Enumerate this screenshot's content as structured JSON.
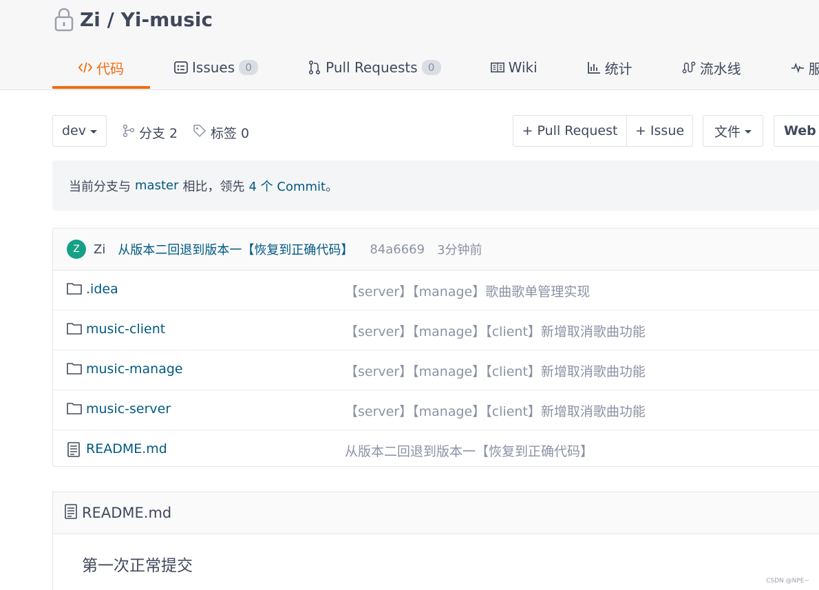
{
  "repo": {
    "title": "Zi / Yi-music"
  },
  "tabs": [
    {
      "label": "代码",
      "icon": "code-icon",
      "active": true
    },
    {
      "label": "Issues",
      "icon": "issues-icon",
      "count": "0"
    },
    {
      "label": "Pull Requests",
      "icon": "pull-request-icon",
      "count": "0"
    },
    {
      "label": "Wiki",
      "icon": "book-icon"
    },
    {
      "label": "统计",
      "icon": "bar-chart-icon"
    },
    {
      "label": "流水线",
      "icon": "pipeline-icon"
    },
    {
      "label": "服务",
      "icon": "pulse-icon"
    }
  ],
  "toolbar": {
    "branch": "dev",
    "branches_label": "分支 2",
    "tags_label": "标签 0",
    "pull_request_label": "+ Pull Request",
    "issue_label": "+ Issue",
    "file_label": "文件",
    "web_label": "Web"
  },
  "notice": {
    "prefix": "当前分支与",
    "branch": "master",
    "middle": "相比，领先",
    "commits": "4 个 Commit",
    "suffix": "。"
  },
  "last_commit": {
    "avatar_letter": "Z",
    "author": "Zi",
    "message": "从版本二回退到版本一【恢复到正确代码】",
    "hash": "84a6669",
    "time": "3分钟前"
  },
  "files": [
    {
      "name": ".idea",
      "type": "folder",
      "message": "【server】【manage】歌曲歌单管理实现"
    },
    {
      "name": "music-client",
      "type": "folder",
      "message": "【server】【manage】【client】新增取消歌曲功能"
    },
    {
      "name": "music-manage",
      "type": "folder",
      "message": "【server】【manage】【client】新增取消歌曲功能"
    },
    {
      "name": "music-server",
      "type": "folder",
      "message": "【server】【manage】【client】新增取消歌曲功能"
    },
    {
      "name": "README.md",
      "type": "file",
      "message": "从版本二回退到版本一【恢复到正确代码】"
    }
  ],
  "readme": {
    "title": "README.md",
    "body": "第一次正常提交"
  },
  "watermark": "CSDN @NPE~"
}
